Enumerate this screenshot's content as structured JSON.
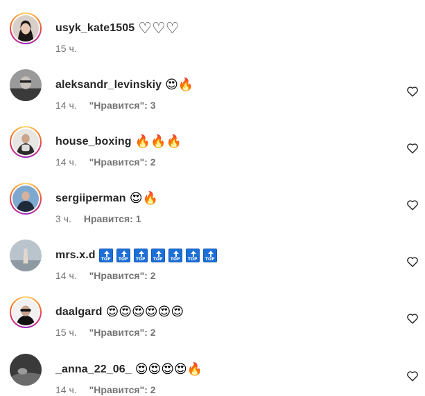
{
  "comments": [
    {
      "username": "usyk_kate1505",
      "text": "♡♡♡",
      "time": "15 ч.",
      "likes": "",
      "story_ring": true,
      "has_like_button": false
    },
    {
      "username": "aleksandr_levinskiy",
      "text": "😍🔥",
      "time": "14 ч.",
      "likes": "\"Нравится\": 3",
      "story_ring": false,
      "has_like_button": true
    },
    {
      "username": "house_boxing",
      "text": "🔥🔥🔥",
      "time": "14 ч.",
      "likes": "\"Нравится\": 2",
      "story_ring": true,
      "has_like_button": true
    },
    {
      "username": "sergiiperman",
      "text": "😍🔥",
      "time": "3 ч.",
      "likes": "Нравится: 1",
      "story_ring": true,
      "has_like_button": true
    },
    {
      "username": "mrs.x.d",
      "text": "🔝🔝🔝🔝🔝🔝🔝",
      "time": "14 ч.",
      "likes": "\"Нравится\": 2",
      "story_ring": false,
      "has_like_button": true
    },
    {
      "username": "daalgard",
      "text": "😍😍😍😍😍😍",
      "time": "15 ч.",
      "likes": "\"Нравится\": 2",
      "story_ring": true,
      "has_like_button": true
    },
    {
      "username": "_anna_22_06_",
      "text": "😍😍😍😍🔥",
      "time": "14 ч.",
      "likes": "\"Нравится\": 2",
      "story_ring": false,
      "has_like_button": true
    }
  ],
  "colors": {
    "username": "#262626",
    "meta": "#737373",
    "heart_emoji": "#e8a820",
    "fire": "#f2680f",
    "top_badge": "#1d6fd8"
  },
  "icons": {
    "like": "heart-outline-icon"
  }
}
